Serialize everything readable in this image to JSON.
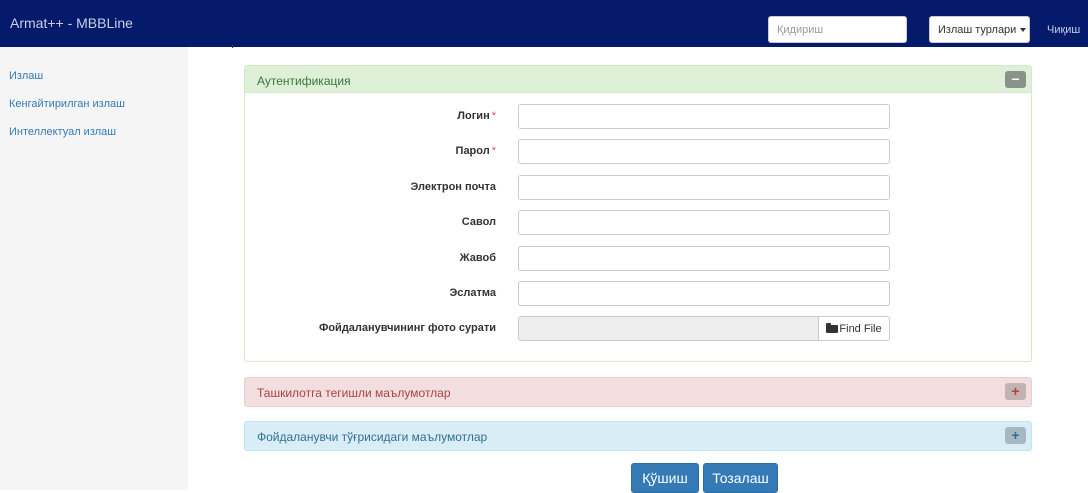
{
  "app": {
    "title": "Armat++ - MBBLine"
  },
  "navbar": {
    "search_placeholder": "Қидириш",
    "search_types_label": "Излаш турлари",
    "logout_label": "Чиқиш"
  },
  "sidebar": {
    "items": [
      {
        "label": "Излаш"
      },
      {
        "label": "Кенгайтирилган излаш"
      },
      {
        "label": "Интеллектуал излаш"
      }
    ]
  },
  "panels": {
    "auth": {
      "title": "Аутентификация",
      "toggle_symbol": "−",
      "fields": [
        {
          "label": "Логин",
          "required_mark": "*",
          "value": ""
        },
        {
          "label": "Парол",
          "required_mark": "*",
          "value": ""
        },
        {
          "label": "Электрон почта",
          "value": ""
        },
        {
          "label": "Савол",
          "value": ""
        },
        {
          "label": "Жавоб",
          "value": ""
        },
        {
          "label": "Эслатма",
          "value": ""
        }
      ],
      "photo_label": "Фойдаланувчининг фото сурати",
      "find_file_label": "Find File"
    },
    "organization": {
      "title": "Ташкилотга тегишли маълумотлар",
      "toggle_symbol": "+"
    },
    "user_info": {
      "title": "Фойдаланувчи тўғрисидаги маълумотлар",
      "toggle_symbol": "+"
    }
  },
  "actions": {
    "add_label": "Қўшиш",
    "clear_label": "Тозалаш"
  },
  "colors": {
    "navbar_bg": "#061a6b",
    "primary": "#337ab7",
    "success_bg": "#dff0d8",
    "danger_bg": "#f2dede",
    "info_bg": "#d9edf7"
  }
}
